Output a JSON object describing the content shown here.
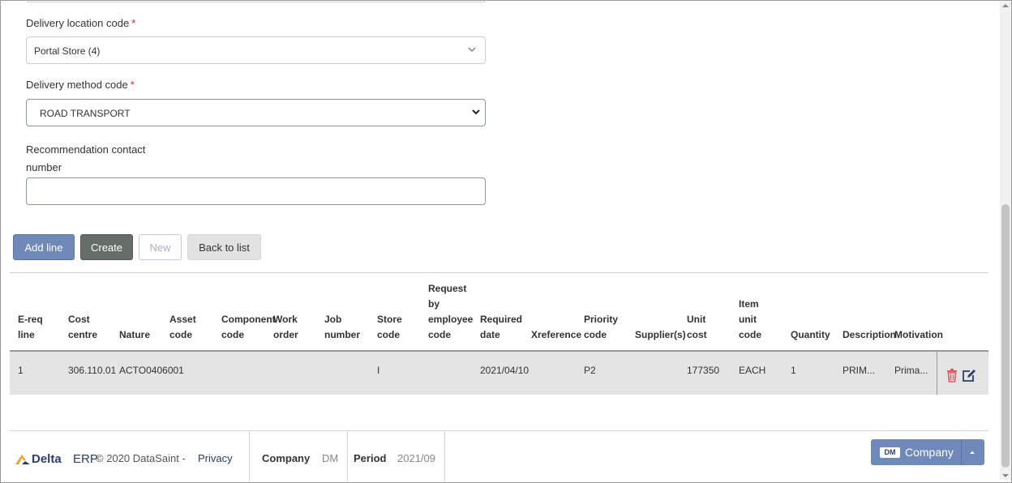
{
  "form": {
    "location": {
      "label": "Delivery location code",
      "required": "*",
      "value": "Portal Store (4)"
    },
    "method": {
      "label": "Delivery method code",
      "required": "*",
      "value": "ROAD TRANSPORT"
    },
    "contact": {
      "label_line1": "Recommendation contact",
      "label_line2": "number",
      "value": ""
    }
  },
  "buttons": {
    "add_line": "Add line",
    "create": "Create",
    "new": "New",
    "back": "Back to list"
  },
  "table": {
    "headers": [
      "E-req\nline",
      "Cost\ncentre",
      "Nature",
      "Asset\ncode",
      "Component\ncode",
      "Work\norder",
      "Job\nnumber",
      "Store\ncode",
      "Request\nby\nemployee\ncode",
      "Required\ndate",
      "Xreference",
      "Priority\ncode",
      "Supplier(s)",
      "Unit\ncost",
      "Item\nunit\ncode",
      "Quantity",
      "Description",
      "Motivation"
    ],
    "row": {
      "ereq_line": "1",
      "cost_centre": "306.110.01",
      "nature": "ACTO0406001",
      "store_code": "I",
      "required_date": "2021/04/10",
      "priority_code": "P2",
      "unit_cost": "177350",
      "item_unit_code": "EACH",
      "quantity": "1",
      "description": "PRIM...",
      "motivation": "Prima..."
    }
  },
  "footer": {
    "logo_text": "Delta",
    "logo_suffix": "ERP",
    "copyright": "© 2020 DataSaint - ",
    "privacy": "Privacy",
    "company_label": "Company",
    "company_value": "DM",
    "period_label": "Period",
    "period_value": "2021/09",
    "company_button_badge": "DM",
    "company_button_label": "Company"
  },
  "colors": {
    "primary": "#6f89b8",
    "create": "#676e6a",
    "danger": "#e0595c",
    "icon": "#2c3e66"
  }
}
